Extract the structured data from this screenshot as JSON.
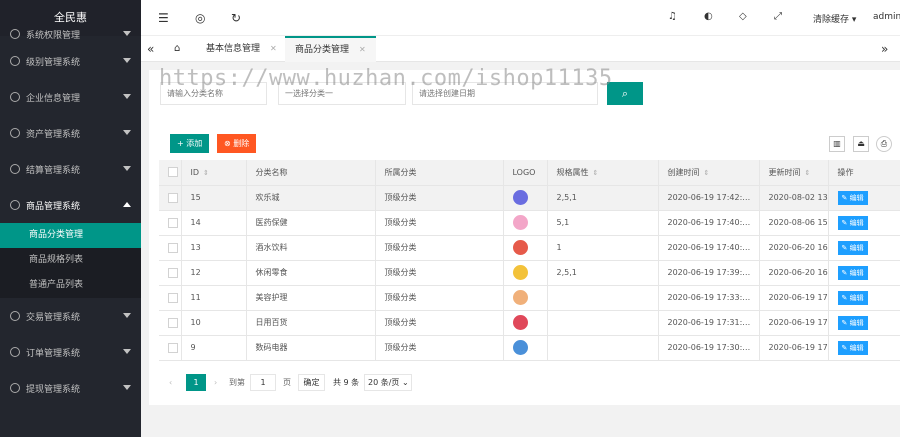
{
  "colors": {
    "accent": "#009688",
    "danger": "#ff5722",
    "edit": "#1e9fff",
    "sidebar_bg": "#23262e"
  },
  "sidebar": {
    "title": "全民惠",
    "items": [
      {
        "label": "系统权限管理"
      },
      {
        "label": "级别管理系统"
      },
      {
        "label": "企业信息管理"
      },
      {
        "label": "资产管理系统"
      },
      {
        "label": "结算管理系统"
      },
      {
        "label": "商品管理系统"
      },
      {
        "label": "交易管理系统"
      },
      {
        "label": "订单管理系统"
      },
      {
        "label": "提现管理系统"
      }
    ],
    "sub_items": [
      {
        "label": "商品分类管理"
      },
      {
        "label": "商品规格列表"
      },
      {
        "label": "普通产品列表"
      }
    ]
  },
  "header": {
    "icons": [
      "menu-fold-icon",
      "globe-icon",
      "refresh-icon",
      "bell-icon",
      "theme-icon",
      "tag-icon",
      "fullscreen-icon"
    ],
    "clear_cache": "清除缓存",
    "user": "admin"
  },
  "tabs": [
    {
      "label": "基本信息管理"
    },
    {
      "label": "商品分类管理"
    }
  ],
  "watermark": "https://www.huzhan.com/ishop11135",
  "search": {
    "placeholder_name": "请输入分类名称",
    "placeholder_parent": "一选择分类一",
    "placeholder_date": "请选择创建日期"
  },
  "toolbar": {
    "add": "+ 添加",
    "delete": "⊗ 删除"
  },
  "table": {
    "columns": [
      "ID",
      "分类名称",
      "所属分类",
      "LOGO",
      "规格属性",
      "创建时间",
      "更新时间",
      "操作"
    ],
    "edit_label": "✎ 编辑",
    "rows": [
      {
        "id": "15",
        "name": "欢乐城",
        "parent": "顶级分类",
        "spec": "2,5,1",
        "created": "2020-06-19 17:42:…",
        "updated": "2020-08-02 13",
        "logo_color": "#6a6de0"
      },
      {
        "id": "14",
        "name": "医药保健",
        "parent": "顶级分类",
        "spec": "5,1",
        "created": "2020-06-19 17:40:…",
        "updated": "2020-08-06 15",
        "logo_color": "#f3a6c8"
      },
      {
        "id": "13",
        "name": "酒水饮料",
        "parent": "顶级分类",
        "spec": "1",
        "created": "2020-06-19 17:40:…",
        "updated": "2020-06-20 16",
        "logo_color": "#e65a4a"
      },
      {
        "id": "12",
        "name": "休闲零食",
        "parent": "顶级分类",
        "spec": "2,5,1",
        "created": "2020-06-19 17:39:…",
        "updated": "2020-06-20 16",
        "logo_color": "#f3c23a"
      },
      {
        "id": "11",
        "name": "美容护理",
        "parent": "顶级分类",
        "spec": "",
        "created": "2020-06-19 17:33:…",
        "updated": "2020-06-19 17",
        "logo_color": "#f0b07a"
      },
      {
        "id": "10",
        "name": "日用百货",
        "parent": "顶级分类",
        "spec": "",
        "created": "2020-06-19 17:31:…",
        "updated": "2020-06-19 17",
        "logo_color": "#e0485a"
      },
      {
        "id": "9",
        "name": "数码电器",
        "parent": "顶级分类",
        "spec": "",
        "created": "2020-06-19 17:30:…",
        "updated": "2020-06-19 17",
        "logo_color": "#4a90d9"
      }
    ]
  },
  "pager": {
    "current": "1",
    "goto": "到第",
    "page_value": "1",
    "page_unit": "页",
    "confirm": "确定",
    "total": "共 9 条",
    "per_page": "20 条/页"
  }
}
